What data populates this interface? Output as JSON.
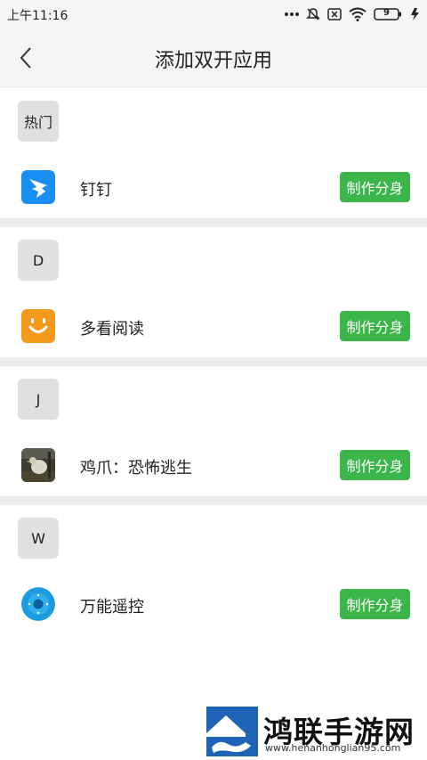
{
  "status_bar": {
    "time": "上午11:16",
    "battery": "9",
    "icons": [
      "dots-icon",
      "mute-icon",
      "sim-off-icon",
      "wifi-icon",
      "battery-icon",
      "charging-icon"
    ]
  },
  "nav": {
    "title": "添加双开应用",
    "back_icon": "chevron-left-icon"
  },
  "sections": [
    {
      "letter": "热门",
      "app_name": "钉钉",
      "button": "制作分身",
      "icon": "dingtalk-icon"
    },
    {
      "letter": "D",
      "app_name": "多看阅读",
      "button": "制作分身",
      "icon": "duokan-icon"
    },
    {
      "letter": "J",
      "app_name": "鸡爪：恐怖逃生",
      "button": "制作分身",
      "icon": "game-icon"
    },
    {
      "letter": "W",
      "app_name": "万能遥控",
      "button": "制作分身",
      "icon": "remote-icon"
    }
  ],
  "watermark": {
    "title": "鸿联手游网",
    "url": "www.henanhonglian95.com"
  },
  "colors": {
    "accent_green": "#3cb54a",
    "badge_gray": "#e0e0e0",
    "divider_gray": "#ececec",
    "header_bg": "#f5f5f5"
  }
}
